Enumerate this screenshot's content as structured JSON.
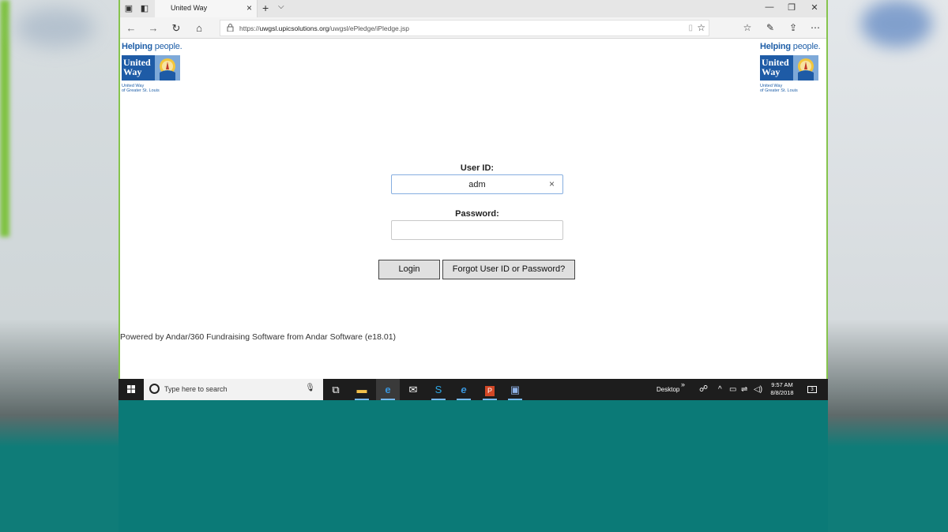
{
  "browser": {
    "tab_title": "United Way",
    "url_scheme": "https://",
    "url_domain": "uwgsl.upicsolutions.org",
    "url_path": "/uwgsl/ePledge/iPledge.jsp"
  },
  "logo": {
    "helping_bold": "Helping",
    "helping_rest": " people.",
    "united": "United",
    "way": "Way",
    "sub_line1": "United Way",
    "sub_line2": "of Greater St. Louis"
  },
  "login": {
    "user_id_label": "User ID:",
    "user_id_value": "adm",
    "password_label": "Password:",
    "password_value": "",
    "login_button": "Login",
    "forgot_button": "Forgot User ID or Password?"
  },
  "footer": {
    "powered_prefix": "Powered by ",
    "powered_product": "Andar/360 Fundraising Software from Andar Software",
    "version": " (e18.01)"
  },
  "taskbar": {
    "search_placeholder": "Type here to search",
    "desktop_label": "Desktop",
    "time": "9:57 AM",
    "date": "8/8/2018",
    "notification_count": "3",
    "pinned_icons": [
      "task-view-icon",
      "file-explorer-icon",
      "edge-icon",
      "mail-icon",
      "skype-icon",
      "internet-explorer-icon",
      "powerpoint-icon",
      "app-icon"
    ]
  },
  "colors": {
    "brand_blue": "#1e5ba6",
    "accent_green": "#86c44d",
    "taskbar": "#1d1d1d"
  }
}
